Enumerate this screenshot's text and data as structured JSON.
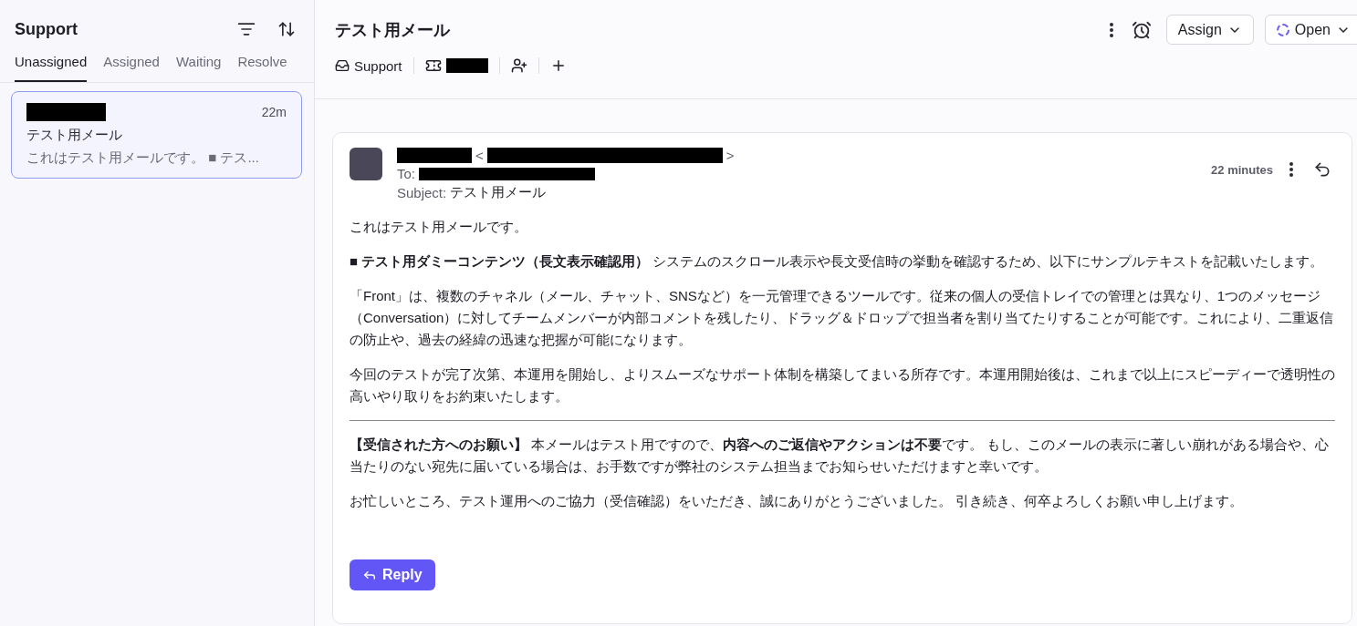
{
  "sidebar": {
    "title": "Support",
    "tabs": [
      {
        "label": "Unassigned",
        "selected": true
      },
      {
        "label": "Assigned",
        "selected": false
      },
      {
        "label": "Waiting",
        "selected": false
      },
      {
        "label": "Resolve",
        "selected": false
      }
    ],
    "conversations": [
      {
        "sender_redacted": true,
        "time": "22m",
        "subject": "テスト用メール",
        "preview": "これはテスト用メールです。 ■ テス...",
        "selected": true
      }
    ]
  },
  "header": {
    "title": "テスト用メール",
    "assign_label": "Assign",
    "status_label": "Open",
    "tags": [
      {
        "kind": "inbox",
        "label": "Support"
      },
      {
        "kind": "ticket",
        "redacted": true
      },
      {
        "kind": "add-person"
      },
      {
        "kind": "add"
      }
    ]
  },
  "message": {
    "sender_redacted": true,
    "email_open": "<",
    "email_close": ">",
    "to_label": "To:",
    "subject_label": "Subject:",
    "subject": "テスト用メール",
    "time": "22 minutes",
    "body": [
      {
        "kind": "paragraph",
        "text": "これはテスト用メールです。"
      },
      {
        "kind": "paragraph",
        "text": "**■ テスト用ダミーコンテンツ（長文表示確認用）**  システムのスクロール表示や長文受信時の挙動を確認するため、以下にサンプルテキストを記載いたします。"
      },
      {
        "kind": "paragraph",
        "text": "「Front」は、複数のチャネル（メール、チャット、SNSなど）を一元管理できるツールです。従来の個人の受信トレイでの管理とは異なり、1つのメッセージ（Conversation）に対してチームメンバーが内部コメントを残したり、ドラッグ＆ドロップで担当者を割り当てたりすることが可能です。これにより、二重返信の防止や、過去の経緯の迅速な把握が可能になります。"
      },
      {
        "kind": "paragraph",
        "text": "今回のテストが完了次第、本運用を開始し、よりスムーズなサポート体制を構築してまいる所存です。本運用開始後は、これまで以上にスピーディーで透明性の高いやり取りをお約束いたします。"
      },
      {
        "kind": "divider"
      },
      {
        "kind": "paragraph",
        "text": "**【受信された方へのお願い】** 本メールはテスト用ですので、**内容へのご返信やアクションは不要**です。 もし、このメールの表示に著しい崩れがある場合や、心当たりのない宛先に届いている場合は、お手数ですが弊社のシステム担当までお知らせいただけますと幸いです。"
      },
      {
        "kind": "paragraph",
        "text": "お忙しいところ、テスト運用へのご協力（受信確認）をいただき、誠にありがとうございました。 引き続き、何卒よろしくお願い申し上げます。"
      }
    ],
    "reply_label": "Reply"
  }
}
